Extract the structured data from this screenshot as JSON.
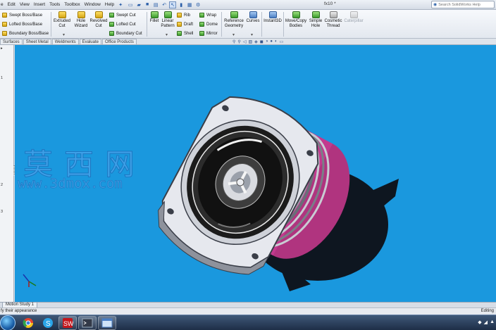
{
  "menu": {
    "items": [
      "e",
      "Edit",
      "View",
      "Insert",
      "Tools",
      "Toolbox",
      "Window",
      "Help"
    ],
    "pin_icon": "pin-icon"
  },
  "quick_access": [
    "new-icon",
    "open-icon",
    "save-icon",
    "print-icon",
    "undo-icon",
    "select-icon",
    "rebuild-icon",
    "file-properties-icon",
    "options-icon"
  ],
  "title": "fx10 *",
  "search": {
    "placeholder": "Search SolidWorks Help"
  },
  "ribbon": {
    "boss": [
      "Swept Boss/Base",
      "Lofted Boss/Base",
      "Boundary Boss/Base"
    ],
    "cuts_big": [
      {
        "label": "Extruded\nCut",
        "icon": "extruded-cut-icon"
      },
      {
        "label": "Hole\nWizard",
        "icon": "hole-wizard-icon"
      },
      {
        "label": "Revolved\nCut",
        "icon": "revolved-cut-icon"
      }
    ],
    "cuts_small": [
      "Swept Cut",
      "Lofted Cut",
      "Boundary Cut"
    ],
    "fillet": "Fillet",
    "linear_pattern": "Linear\nPattern",
    "features_small_a": [
      "Rib",
      "Draft",
      "Shell"
    ],
    "features_small_b": [
      "Wrap",
      "Dome",
      "Mirror"
    ],
    "reference_geometry": "Reference\nGeometry",
    "curves": "Curves",
    "instant3d": "Instant3D",
    "move_copy": "Move/Copy\nBodies",
    "simple_hole": "Simple\nHole",
    "cosmetic_thread": "Cosmetic\nThread",
    "caterpillar": "Caterpillar"
  },
  "tabs": [
    "Surfaces",
    "Sheet Metal",
    "Weldments",
    "Evaluate",
    "Office Products"
  ],
  "ruler": [
    "1",
    "2",
    "3"
  ],
  "watermark": {
    "cn": "莫西网",
    "url": "www.3dmox.com"
  },
  "motion_tab": "Motion Study 1",
  "status": {
    "text": "fy their appearance",
    "mode": "Editing"
  },
  "colors": {
    "viewport": "#1a98de",
    "speaker_basket": "#e6e8ee",
    "speaker_magnet": "#c23a8e",
    "cone": "#1b1b1b"
  }
}
